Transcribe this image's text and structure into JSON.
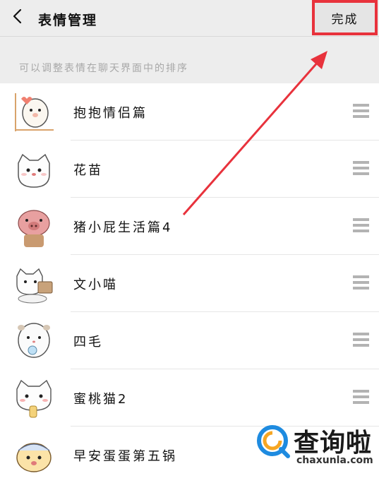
{
  "header": {
    "back_icon": "chevron-left-icon",
    "title": "表情管理",
    "done_label": "完成"
  },
  "hint": "可以调整表情在聊天界面中的排序",
  "stickers": [
    {
      "name": "抱抱情侣篇",
      "icon": "seal-sticker-icon"
    },
    {
      "name": "花苗",
      "icon": "cat-sticker-icon"
    },
    {
      "name": "猪小屁生活篇4",
      "icon": "pig-sticker-icon"
    },
    {
      "name": "文小喵",
      "icon": "cat-sticker-icon"
    },
    {
      "name": "四毛",
      "icon": "hamster-sticker-icon"
    },
    {
      "name": "蜜桃猫2",
      "icon": "cat-sticker-icon"
    },
    {
      "name": "早安蛋蛋第五锅",
      "icon": "hamster-sticker-icon"
    }
  ],
  "watermark": {
    "text": "查询啦",
    "sub": "chaxunla.com"
  },
  "colors": {
    "highlight": "#e8323c",
    "background": "#ededed",
    "handle": "#b3b3b3"
  }
}
